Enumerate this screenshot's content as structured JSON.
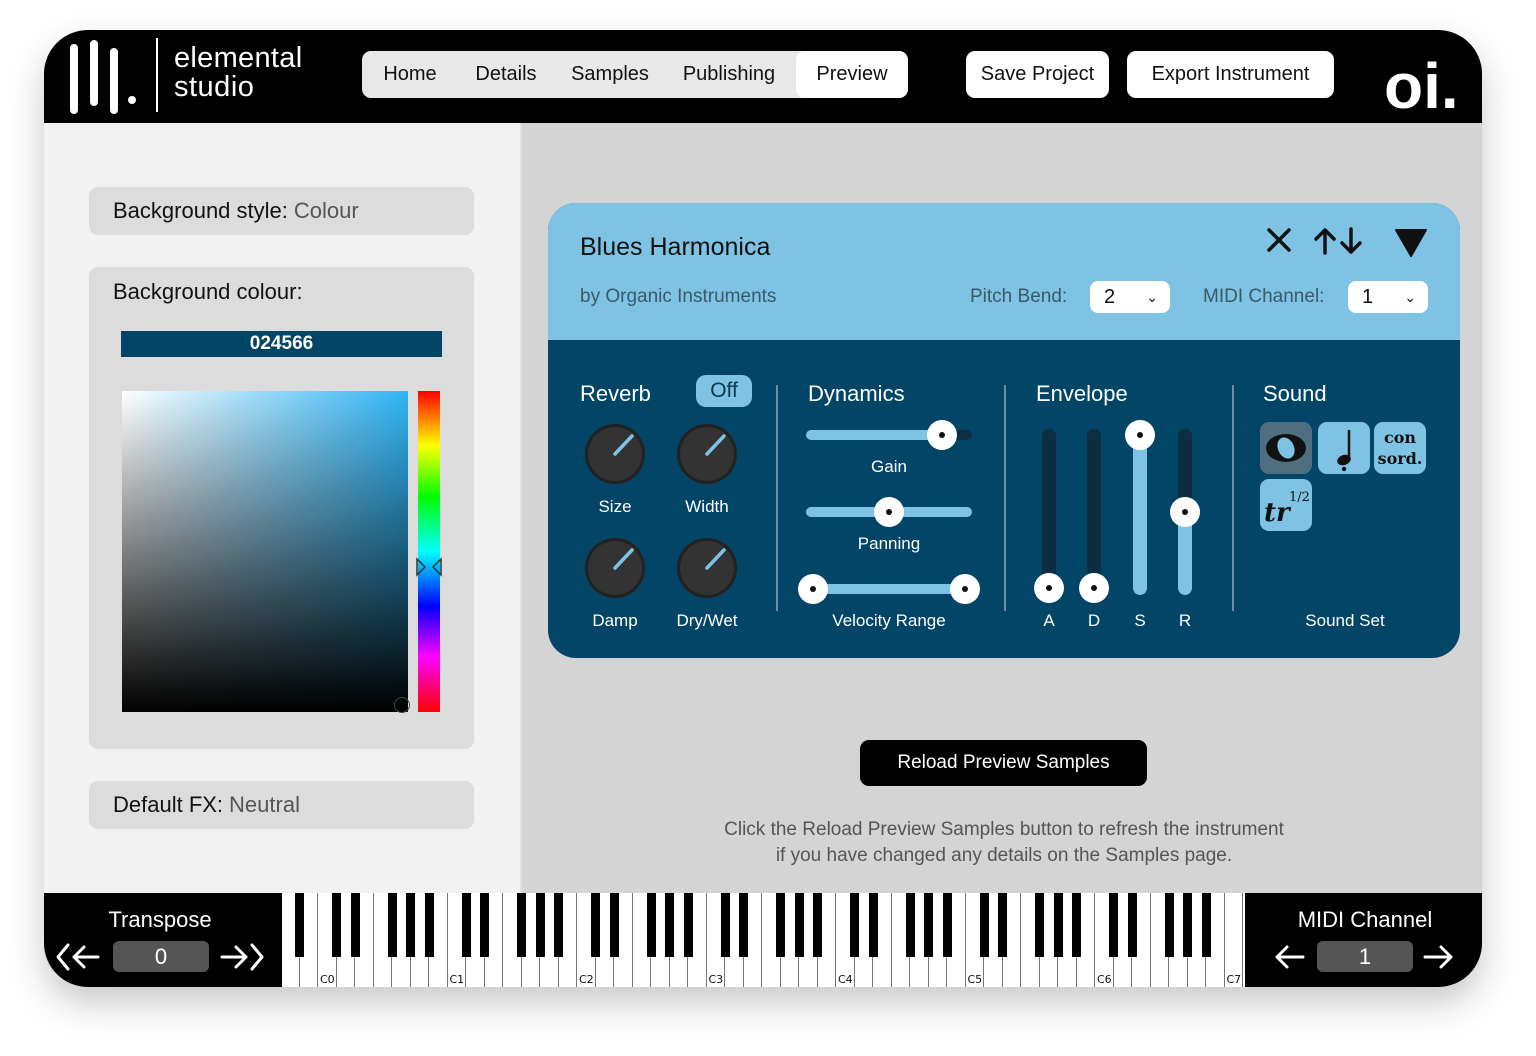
{
  "app": {
    "logo_line1": "elemental",
    "logo_line2": "studio",
    "brand_logo": "oi."
  },
  "nav": {
    "tabs": [
      {
        "label": "Home",
        "active": false
      },
      {
        "label": "Details",
        "active": false
      },
      {
        "label": "Samples",
        "active": false
      },
      {
        "label": "Publishing",
        "active": false
      },
      {
        "label": "Preview",
        "active": true
      }
    ]
  },
  "toolbar": {
    "save_label": "Save Project",
    "export_label": "Export Instrument"
  },
  "settings": {
    "background_style_label": "Background style:",
    "background_style_value": "Colour",
    "background_colour_label": "Background colour:",
    "hex_value": "024566",
    "default_fx_label": "Default FX:",
    "default_fx_value": "Neutral"
  },
  "instrument": {
    "name": "Blues Harmonica",
    "by": "by Organic Instruments",
    "pitch_bend_label": "Pitch Bend:",
    "pitch_bend_value": "2",
    "midi_channel_label": "MIDI Channel:",
    "midi_channel_value": "1",
    "reverb": {
      "title": "Reverb",
      "toggle": "Off",
      "knobs": [
        {
          "label": "Size",
          "value": 0.7
        },
        {
          "label": "Width",
          "value": 0.7
        },
        {
          "label": "Damp",
          "value": 0.7
        },
        {
          "label": "Dry/Wet",
          "value": 0.7
        }
      ]
    },
    "dynamics": {
      "title": "Dynamics",
      "gain_label": "Gain",
      "gain_value": 0.8,
      "panning_label": "Panning",
      "panning_value": 0.5,
      "velocity_label": "Velocity Range",
      "velocity_min": 0.0,
      "velocity_max": 1.0
    },
    "envelope": {
      "title": "Envelope",
      "sliders": [
        {
          "label": "A",
          "value": 0.0
        },
        {
          "label": "D",
          "value": 0.0
        },
        {
          "label": "S",
          "value": 1.0
        },
        {
          "label": "R",
          "value": 0.5
        }
      ]
    },
    "sound": {
      "title": "Sound",
      "buttons": [
        "ordinario-icon",
        "staccato-note-icon",
        "con-sord-icon",
        "half-trill-icon"
      ],
      "con_sord_line1": "con",
      "con_sord_line2": "sord.",
      "trill_text": "tr",
      "trill_fraction": "1/2",
      "sound_set_label": "Sound Set"
    }
  },
  "preview": {
    "reload_label": "Reload Preview Samples",
    "hint_line1": "Click the Reload Preview Samples button to refresh the instrument",
    "hint_line2": "if you have changed any details on the Samples page."
  },
  "footer": {
    "transpose_label": "Transpose",
    "transpose_value": "0",
    "midi_channel_label": "MIDI Channel",
    "midi_channel_value": "1",
    "octave_labels": [
      "C0",
      "C1",
      "C2",
      "C3",
      "C4",
      "C5",
      "C6",
      "C7"
    ]
  },
  "colors": {
    "accent": "#024566",
    "light_blue": "#7ec3e3",
    "header": "#000000"
  }
}
